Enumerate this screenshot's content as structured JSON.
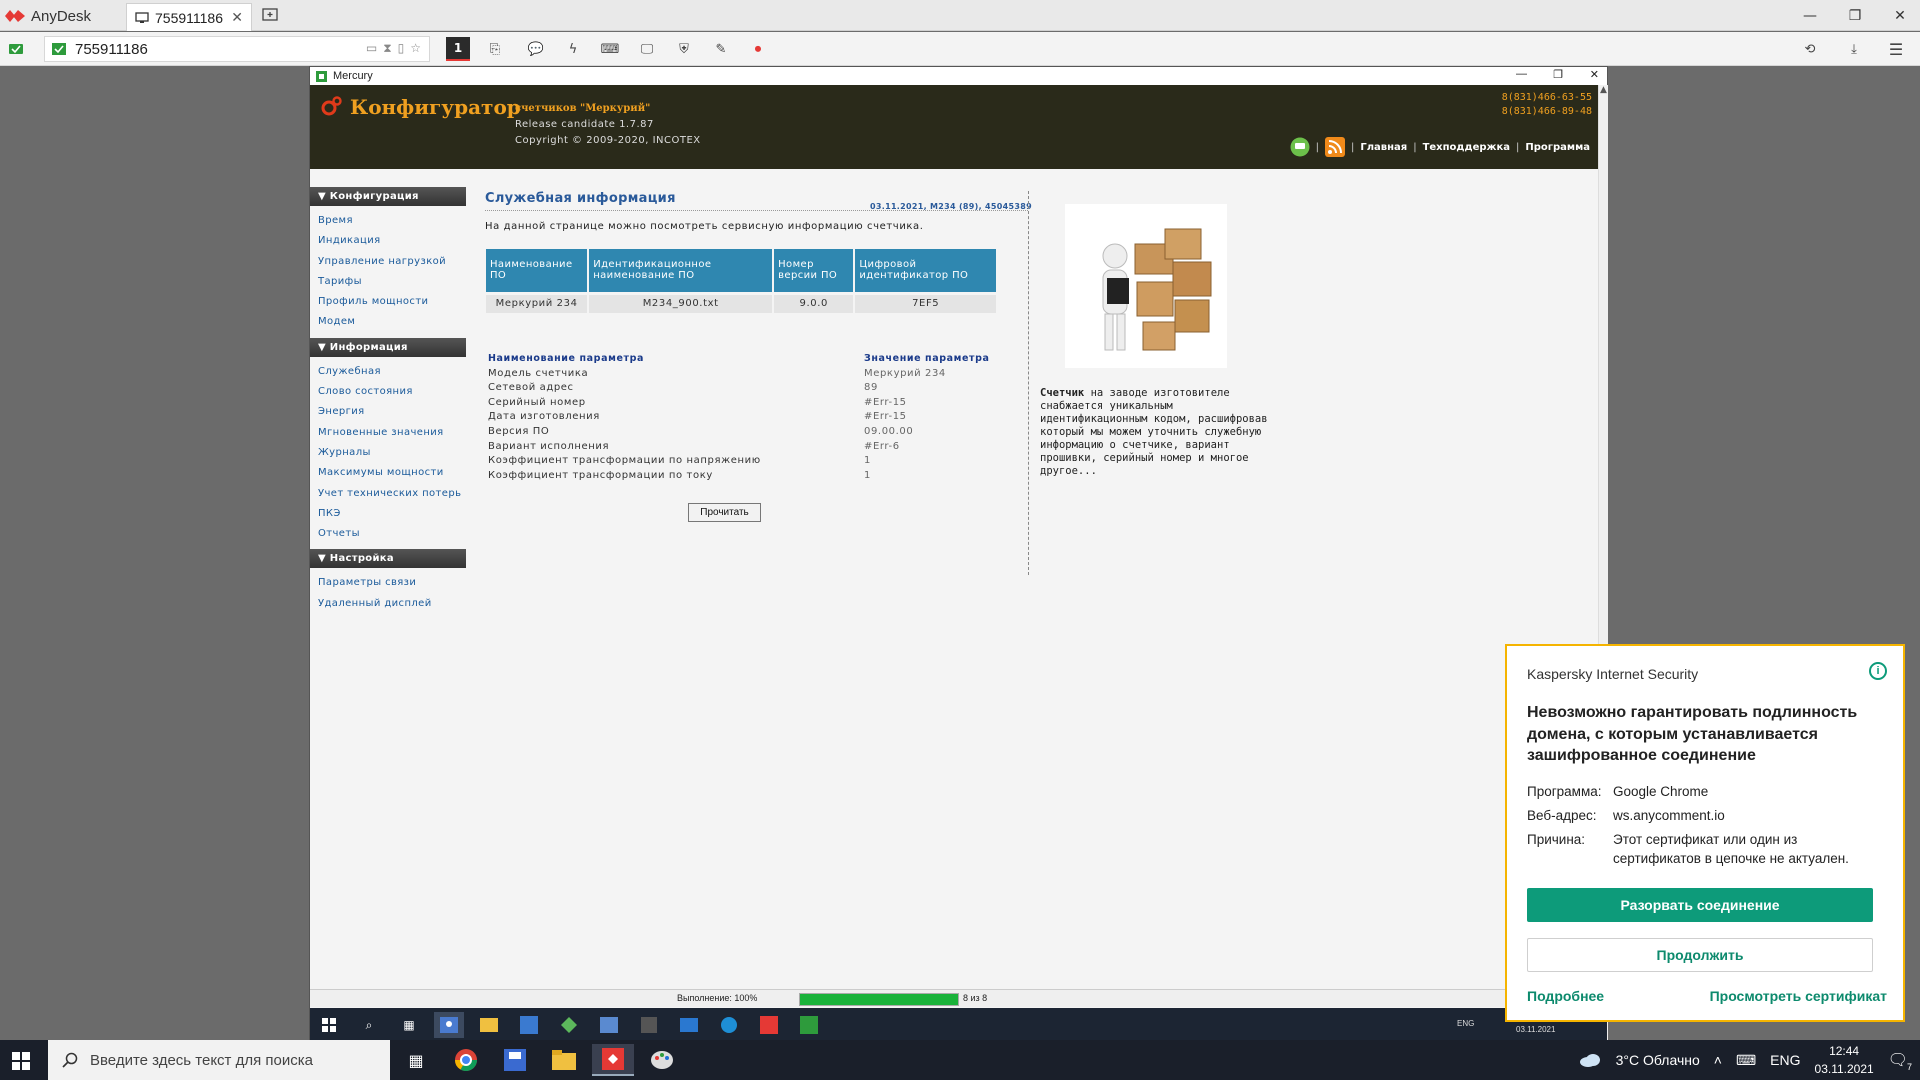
{
  "anydesk": {
    "brand": "AnyDesk",
    "tab_label": "755911186",
    "address": "755911186",
    "monitor_index": "1"
  },
  "remote": {
    "window_title": "Mercury",
    "header": {
      "brand": "Конфигуратор",
      "subtitle": "счетчиков \"Меркурий\"",
      "release": "Release candidate 1.7.87",
      "copyright": "Copyright © 2009-2020, INCOTEX",
      "phone1": "8(831)466-63-55",
      "phone2": "8(831)466-89-48",
      "nav": [
        "Главная",
        "Техподдержка",
        "Программа"
      ],
      "nav_sep": "|"
    },
    "sidebar": {
      "sections": [
        {
          "title": "▼ Конфигурация",
          "items": [
            "Время",
            "Индикация",
            "Управление нагрузкой",
            "Тарифы",
            "Профиль мощности",
            "Модем"
          ]
        },
        {
          "title": "▼ Информация",
          "items": [
            "Служебная",
            "Слово состояния",
            "Энергия",
            "Мгновенные значения",
            "Журналы",
            "Максимумы мощности",
            "Учет технических потерь",
            "ПКЭ",
            "Отчеты"
          ]
        },
        {
          "title": "▼ Настройка",
          "items": [
            "Параметры связи",
            "Удаленный дисплей"
          ]
        }
      ]
    },
    "page": {
      "title": "Служебная информация",
      "meta": "03.11.2021, M234 (89), 45045389",
      "description": "На данной странице можно посмотреть сервисную информацию счетчика.",
      "sw_table": {
        "headers": [
          "Наименование ПО",
          "Идентификационное наименование ПО",
          "Номер версии ПО",
          "Цифровой идентификатор ПО"
        ],
        "row": [
          "Меркурий 234",
          "M234_900.txt",
          "9.0.0",
          "7EF5"
        ]
      },
      "params": {
        "header_name": "Наименование параметра",
        "header_value": "Значение параметра",
        "rows": [
          {
            "name": "Модель счетчика",
            "value": "Меркурий 234"
          },
          {
            "name": "Сетевой адрес",
            "value": "89"
          },
          {
            "name": "Серийный номер",
            "value": "#Err-15"
          },
          {
            "name": "Дата изготовления",
            "value": "#Err-15"
          },
          {
            "name": "Версия ПО",
            "value": "09.00.00"
          },
          {
            "name": "Вариант исполнения",
            "value": "#Err-6"
          },
          {
            "name": "Коэффициент трансформации по напряжению",
            "value": "1"
          },
          {
            "name": "Коэффициент трансформации по току",
            "value": "1"
          }
        ]
      },
      "read_button": "Прочитать",
      "info_bold": "Счетчик",
      "info_text": " на заводе изготовителе снабжается уникальным идентификационным кодом, расшифровав который мы можем уточнить служебную информацию о счетчике, вариант прошивки, серийный номер и многое другое..."
    },
    "status": {
      "progress_label": "Выполнение: 100%",
      "progress_fraction": 1.0,
      "count": "8 из 8"
    },
    "taskbar": {
      "lang": "ENG",
      "date": "03.11.2021"
    }
  },
  "kaspersky": {
    "app": "Kaspersky Internet Security",
    "headline": "Невозможно гарантировать подлинность домена, с которым устанавливается зашифрованное соединение",
    "program_label": "Программа:",
    "program_value": "Google Chrome",
    "address_label": "Веб-адрес:",
    "address_value": "ws.anycomment.io",
    "reason_label": "Причина:",
    "reason_value": "Этот сертификат или один из сертификатов в цепочке не актуален.",
    "disconnect": "Разорвать соединение",
    "continue": "Продолжить",
    "more": "Подробнее",
    "view_cert": "Просмотреть сертификат",
    "colors": {
      "accent": "#0d9b7a",
      "border": "#f5b400"
    }
  },
  "windows": {
    "search_placeholder": "Введите здесь текст для поиска",
    "weather": "3°C Облачно",
    "lang": "ENG",
    "time": "12:44",
    "date": "03.11.2021",
    "notifications": "7"
  }
}
